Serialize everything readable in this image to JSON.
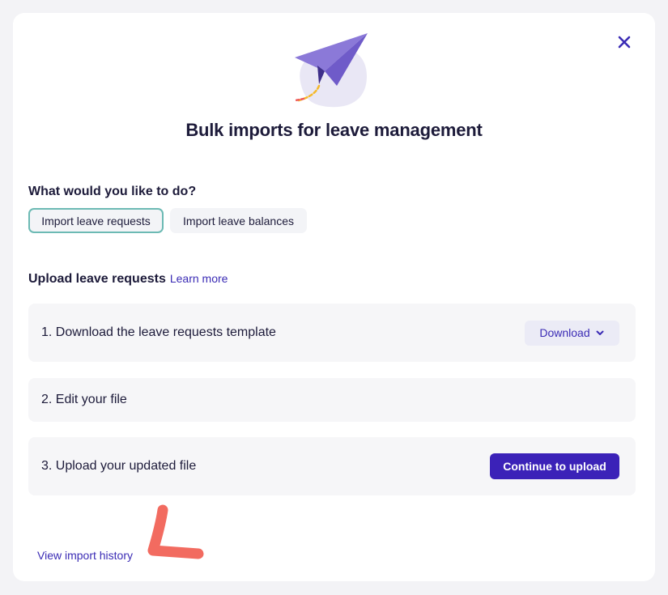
{
  "modal": {
    "title": "Bulk imports for leave management",
    "close_icon": "close-icon",
    "illustration": "paper-plane-illustration"
  },
  "choices": {
    "question": "What would you like to do?",
    "options": [
      {
        "label": "Import leave requests",
        "selected": true
      },
      {
        "label": "Import leave balances",
        "selected": false
      }
    ]
  },
  "upload": {
    "heading": "Upload leave requests",
    "learn_more": "Learn more",
    "steps": [
      {
        "label": "1. Download the leave requests template",
        "action": "Download",
        "action_icon": "chevron-down-icon"
      },
      {
        "label": "2. Edit your file"
      },
      {
        "label": "3. Upload your updated file",
        "action": "Continue to upload"
      }
    ]
  },
  "footer": {
    "history_link": "View import history"
  },
  "colors": {
    "accent": "#3b22b8",
    "link": "#3b2cb5",
    "selected_border": "#6cbab4",
    "annotation": "#f26b60"
  }
}
